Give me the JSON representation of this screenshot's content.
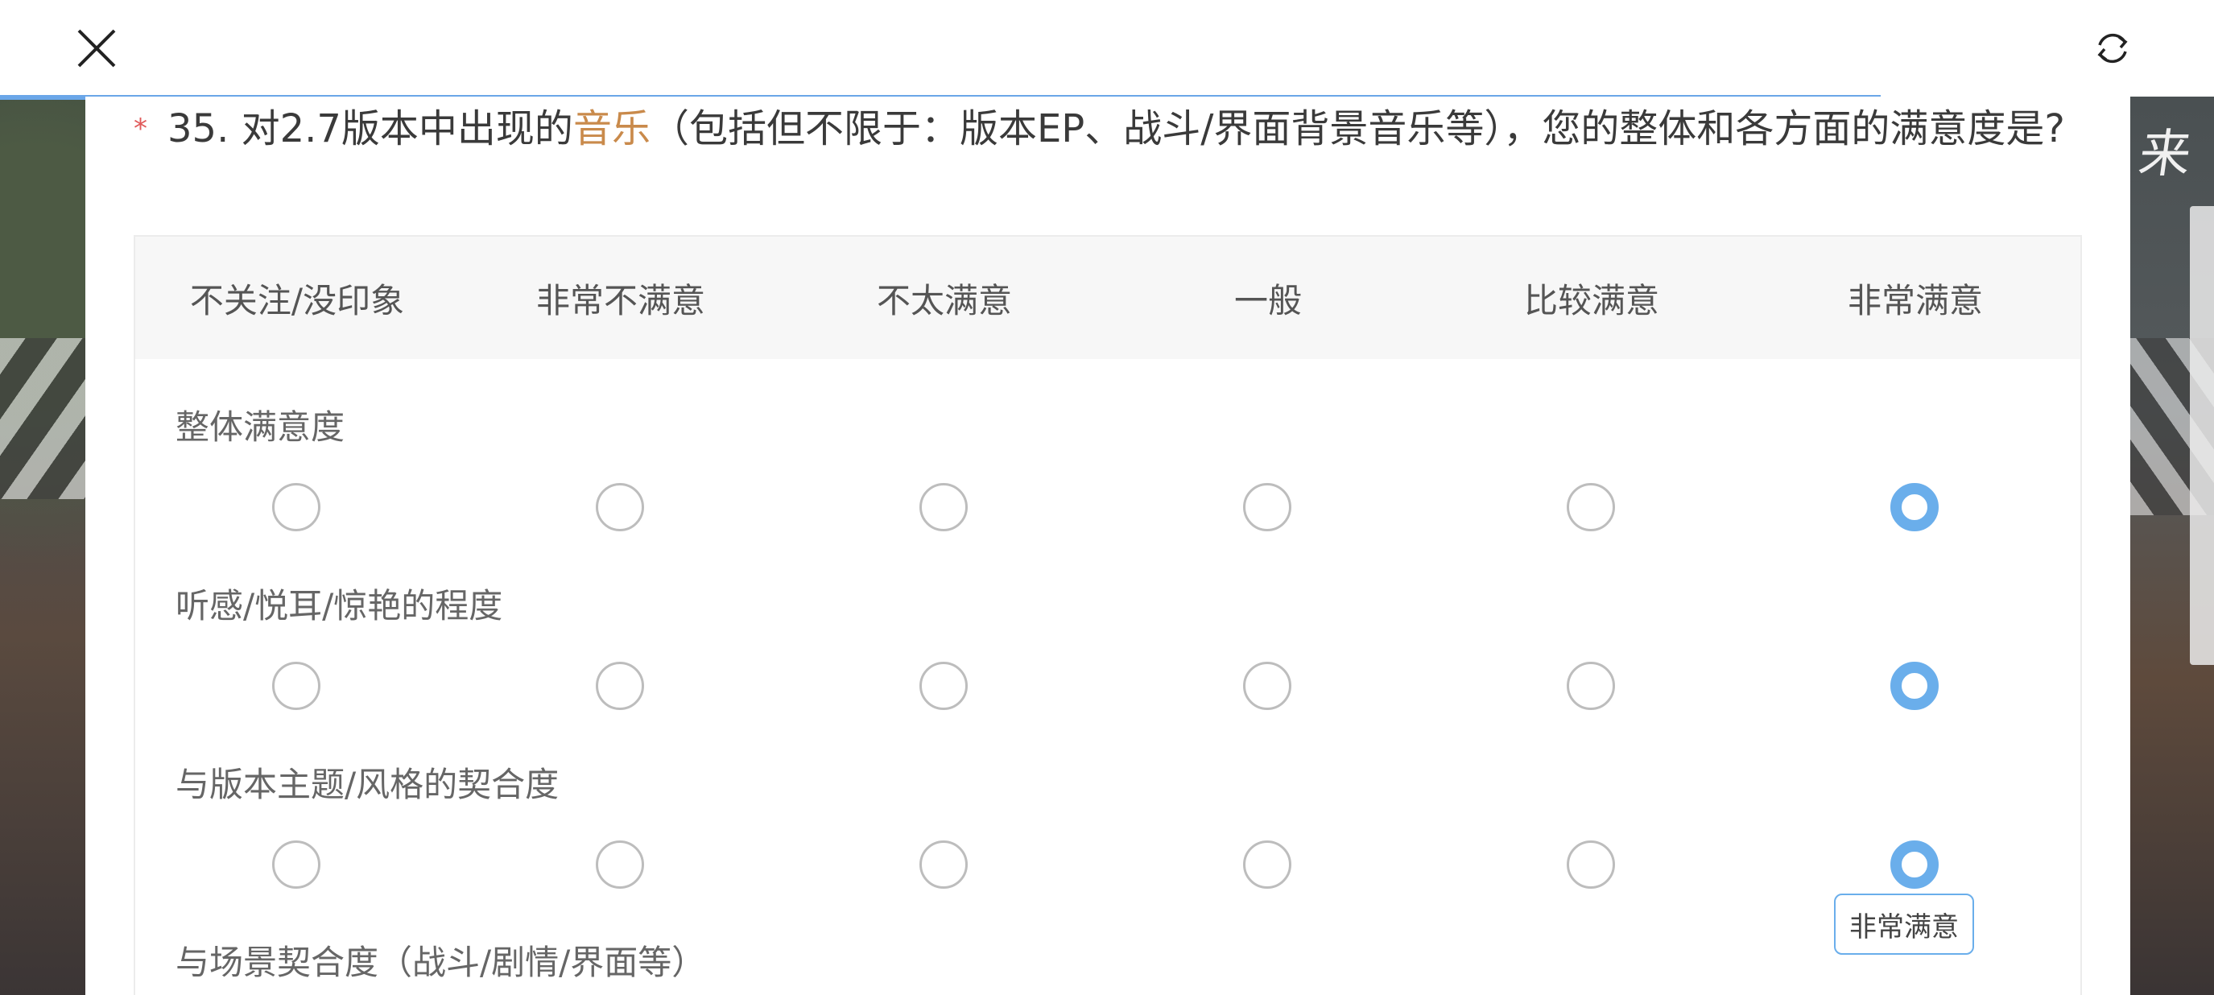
{
  "question": {
    "required_mark": "*",
    "prefix": "35. 对2.7版本中出现的",
    "highlight": "音乐",
    "suffix": "（包括但不限于：版本EP、战斗/界面背景音乐等），您的整体和各方面的满意度是?",
    "highlight_color": "#c98a4b"
  },
  "matrix": {
    "columns": [
      "不关注/没印象",
      "非常不满意",
      "不太满意",
      "一般",
      "比较满意",
      "非常满意"
    ],
    "rows": [
      {
        "label": "整体满意度",
        "selected": 5
      },
      {
        "label": "听感/悦耳/惊艳的程度",
        "selected": 5
      },
      {
        "label": "与版本主题/风格的契合度",
        "selected": 5
      },
      {
        "label": "与场景契合度（战斗/剧情/界面等）",
        "selected": null
      }
    ],
    "accent_color": "#6aaeeb"
  },
  "tooltip": {
    "text": "非常满意"
  },
  "right_logo": {
    "text": "来"
  }
}
